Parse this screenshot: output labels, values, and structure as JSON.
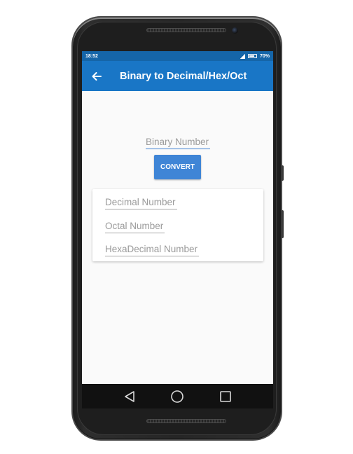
{
  "status_bar": {
    "time": "18:52",
    "battery": "70%"
  },
  "app_bar": {
    "title": "Binary to Decimal/Hex/Oct",
    "back_icon": "arrow-back-icon"
  },
  "form": {
    "binary_placeholder": "Binary Number",
    "convert_label": "CONVERT"
  },
  "results": {
    "decimal_placeholder": "Decimal Number",
    "octal_placeholder": "Octal Number",
    "hex_placeholder": "HexaDecimal Number"
  },
  "nav_bar": {
    "back_icon": "triangle-back-icon",
    "home_icon": "circle-home-icon",
    "recents_icon": "square-recents-icon"
  },
  "colors": {
    "app_bar": "#1976c6",
    "status_bar": "#1565a8",
    "accent_button": "#3f85d6"
  }
}
